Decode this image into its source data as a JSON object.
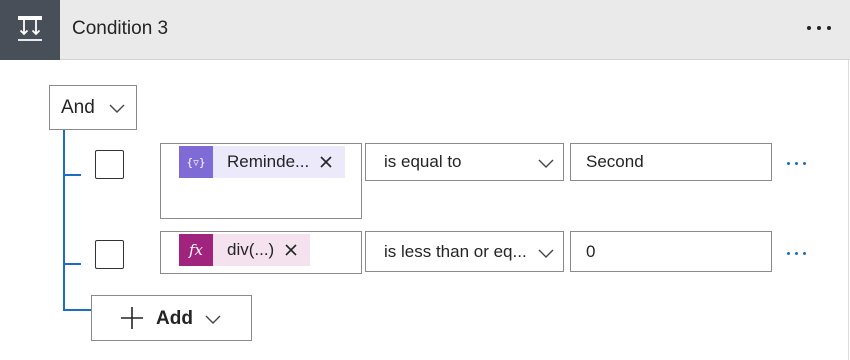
{
  "header": {
    "title": "Condition 3",
    "icon": "condition-icon",
    "more_icon": "more-horizontal-icon"
  },
  "group": {
    "operator": "And"
  },
  "rows": [
    {
      "token": {
        "label": "Reminde...",
        "icon": "variable-icon",
        "color": "#7e6bd6",
        "bg": "#ece9fb"
      },
      "operator": "is equal to",
      "value": "Second"
    },
    {
      "token": {
        "label": "div(...)",
        "icon": "fx-icon",
        "color": "#a0247d",
        "bg": "#f4e3ef"
      },
      "operator": "is less than or eq...",
      "value": "0"
    }
  ],
  "add": {
    "label": "Add"
  },
  "colors": {
    "accent": "#1b6ec2",
    "header_bg": "#eaeaea",
    "header_icon_bg": "#484f58"
  }
}
